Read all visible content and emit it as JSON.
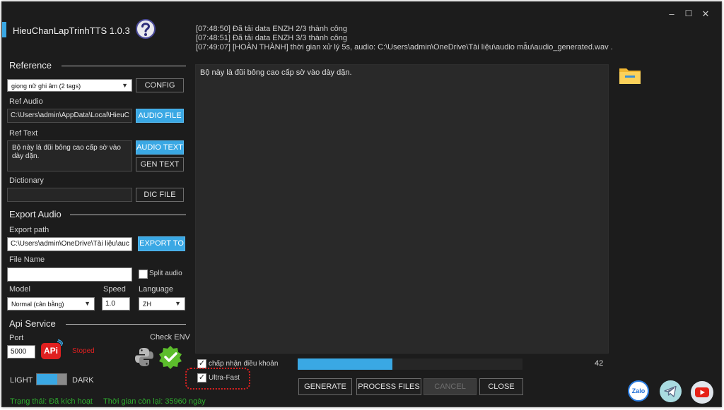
{
  "app": {
    "title": "HieuChanLapTrinhTTS 1.0.3",
    "help_icon": "question-mark-icon",
    "window_controls": {
      "minimize": "–",
      "maximize": "☐",
      "close": "✕"
    }
  },
  "log": {
    "lines": [
      "[07:48:50] Đã tải data ENZH 2/3 thành công",
      "[07:48:51] Đã tải data ENZH 3/3 thành công",
      "[07:49:07] [HOÀN THÀNH] thời gian xử lý 5s, audio: C:\\Users\\admin\\OneDrive\\Tài liệu\\audio mẫu\\audio_generated.wav ."
    ]
  },
  "editor": {
    "text": "Bộ này là đũi bông cao cấp sờ vào dày dặn."
  },
  "reference": {
    "title": "Reference",
    "voice_select": "giọng nữ ghi âm (2 tags)",
    "config_button": "CONFIG",
    "ref_audio_label": "Ref Audio",
    "ref_audio_path": "C:\\Users\\admin\\AppData\\Local\\HieuC",
    "audio_file_button": "AUDIO FILE",
    "ref_text_label": "Ref Text",
    "ref_text_value": "Bộ này là đũi bông cao cấp sờ vào dày dặn.",
    "audio_text_button": "AUDIO TEXT",
    "gen_text_button": "GEN TEXT",
    "dictionary_label": "Dictionary",
    "dictionary_value": "",
    "dic_file_button": "DIC FILE"
  },
  "export": {
    "title": "Export Audio",
    "path_label": "Export path",
    "path_value": "C:\\Users\\admin\\OneDrive\\Tài liệu\\auc",
    "export_button": "EXPORT TO",
    "file_name_label": "File Name",
    "file_name_value": "",
    "split_audio_label": "Split audio",
    "model_label": "Model",
    "model_value": "Normal (cân bằng)",
    "speed_label": "Speed",
    "speed_value": "1.0",
    "language_label": "Language",
    "language_value": "ZH"
  },
  "api": {
    "title": "Api Service",
    "port_label": "Port",
    "port_value": "5000",
    "api_badge": "APi",
    "status": "Stoped",
    "check_env_label": "Check ENV"
  },
  "theme": {
    "light_label": "LIGHT",
    "dark_label": "DARK"
  },
  "status_bar": {
    "state": "Trạng thái: Đã kích hoạt",
    "time_left": "Thời gian còn lại: 35960 ngày"
  },
  "bottom": {
    "accept_terms_label": "chấp nhận điều khoản",
    "ultra_fast_label": "Ultra-Fast",
    "progress_value": 42,
    "progress_label": "42",
    "generate_button": "GENERATE",
    "process_button": "PROCESS FILES",
    "cancel_button": "CANCEL",
    "close_button": "CLOSE"
  },
  "social": {
    "zalo_label": "Zalo"
  },
  "colors": {
    "accent": "#3aa8e4",
    "background": "#1c1c1c",
    "status_green": "#2fae2f",
    "stopped_red": "#e02020",
    "highlight_red": "#e02020"
  }
}
